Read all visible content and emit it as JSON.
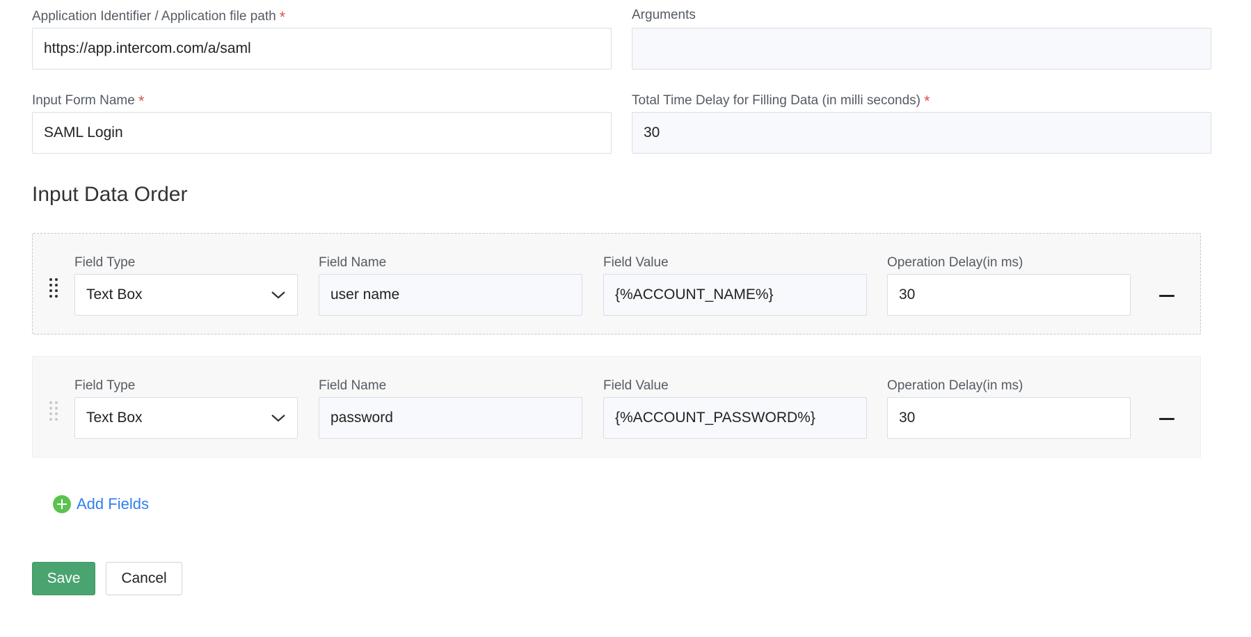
{
  "form": {
    "app_identifier": {
      "label": "Application Identifier / Application file path",
      "required_mark": "*",
      "value": "https://app.intercom.com/a/saml"
    },
    "arguments": {
      "label": "Arguments",
      "value": ""
    },
    "input_form_name": {
      "label": "Input Form Name",
      "required_mark": "*",
      "value": "SAML Login"
    },
    "total_time_delay": {
      "label": "Total Time Delay for Filling Data (in milli seconds)",
      "required_mark": "*",
      "value": "30"
    }
  },
  "input_data_order": {
    "title": "Input Data Order",
    "rows": [
      {
        "field_type_label": "Field Type",
        "field_type_value": "Text Box",
        "field_name_label": "Field Name",
        "field_name_value": "user name",
        "field_value_label": "Field Value",
        "field_value_value": "{%ACCOUNT_NAME%}",
        "operation_delay_label": "Operation Delay(in ms)",
        "operation_delay_value": "30"
      },
      {
        "field_type_label": "Field Type",
        "field_type_value": "Text Box",
        "field_name_label": "Field Name",
        "field_name_value": "password",
        "field_value_label": "Field Value",
        "field_value_value": "{%ACCOUNT_PASSWORD%}",
        "operation_delay_label": "Operation Delay(in ms)",
        "operation_delay_value": "30"
      }
    ],
    "add_fields_label": "Add Fields"
  },
  "actions": {
    "save_label": "Save",
    "cancel_label": "Cancel"
  },
  "icons": {
    "drag_handle": "drag-handle-icon",
    "chevron": "chevron-down-icon",
    "remove": "minus-icon",
    "add": "plus-circle-icon"
  },
  "colors": {
    "required": "#d9534f",
    "link": "#2f80ed",
    "add_icon": "#5cc24f",
    "save_button": "#4aa46f"
  }
}
